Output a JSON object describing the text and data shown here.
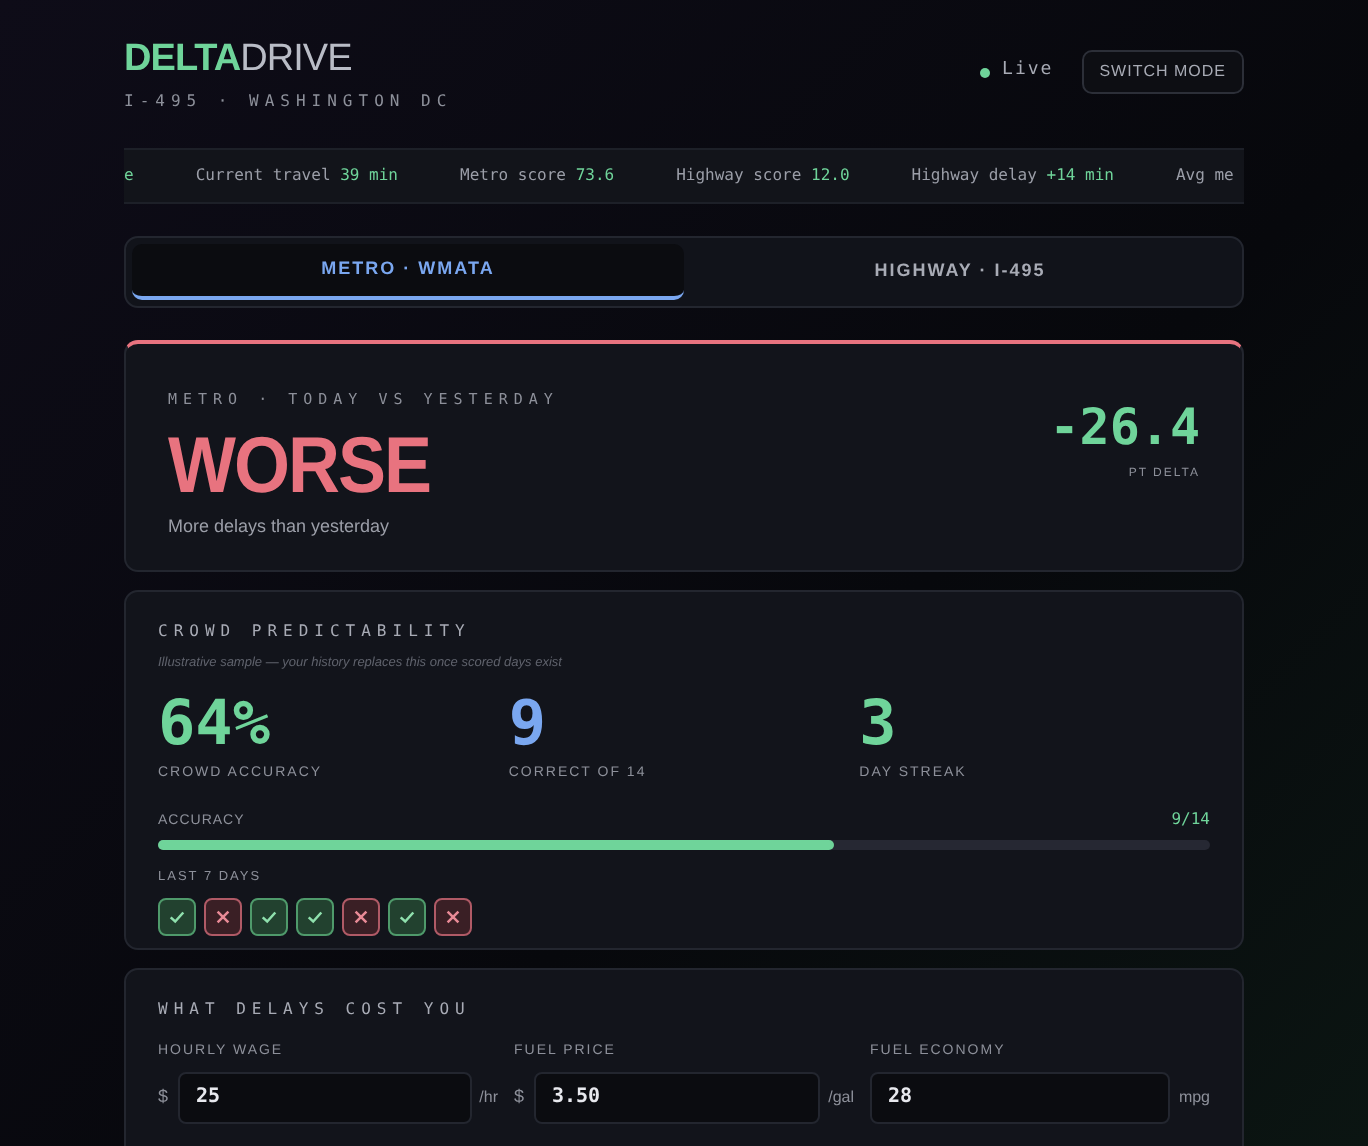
{
  "brand": {
    "part1": "DELTA",
    "part2": "DRIVE",
    "subtitle": "I-495 · WASHINGTON DC"
  },
  "status": {
    "label": "Live",
    "live": true
  },
  "mode_button": "SWITCH MODE",
  "ticker": [
    {
      "value": "e"
    },
    {
      "label": "Current travel",
      "value": "39 min"
    },
    {
      "label": "Metro score",
      "value": "73.6"
    },
    {
      "label": "Highway score",
      "value": "12.0"
    },
    {
      "label": "Highway delay",
      "value": "+14 min"
    },
    {
      "label": "Avg me"
    }
  ],
  "tabs": [
    {
      "label": "METRO · WMATA",
      "selected": true
    },
    {
      "label": "HIGHWAY · I-495",
      "selected": false
    }
  ],
  "verdict": {
    "eyebrow": "METRO · TODAY VS YESTERDAY",
    "headline": "WORSE",
    "color": "#e8737f",
    "note": "More delays than yesterday",
    "delta": "-26.4",
    "delta_label": "PT DELTA"
  },
  "crowd": {
    "title": "CROWD PREDICTABILITY",
    "caption": "Illustrative sample — your history replaces this once scored days exist",
    "stats": [
      {
        "value": "64%",
        "label": "CROWD ACCURACY",
        "color": "#6fd49a"
      },
      {
        "value": "9",
        "label": "CORRECT OF 14",
        "color": "#7aa7f0"
      },
      {
        "value": "3",
        "label": "DAY STREAK",
        "color": "#6fd49a"
      }
    ],
    "accuracy_label": "ACCURACY",
    "accuracy_reading": "9/14",
    "level": 0.643,
    "days_label": "LAST 7 DAYS",
    "days": [
      {
        "correct": true
      },
      {
        "correct": false
      },
      {
        "correct": true
      },
      {
        "correct": true
      },
      {
        "correct": false
      },
      {
        "correct": true
      },
      {
        "correct": false
      }
    ]
  },
  "cost": {
    "title": "WHAT DELAYS COST YOU",
    "fields": [
      {
        "label": "HOURLY WAGE",
        "prefix": "$",
        "value": "25",
        "suffix": "/hr"
      },
      {
        "label": "FUEL PRICE",
        "prefix": "$",
        "value": "3.50",
        "suffix": "/gal"
      },
      {
        "label": "FUEL ECONOMY",
        "value": "28",
        "suffix": "mpg"
      }
    ]
  }
}
